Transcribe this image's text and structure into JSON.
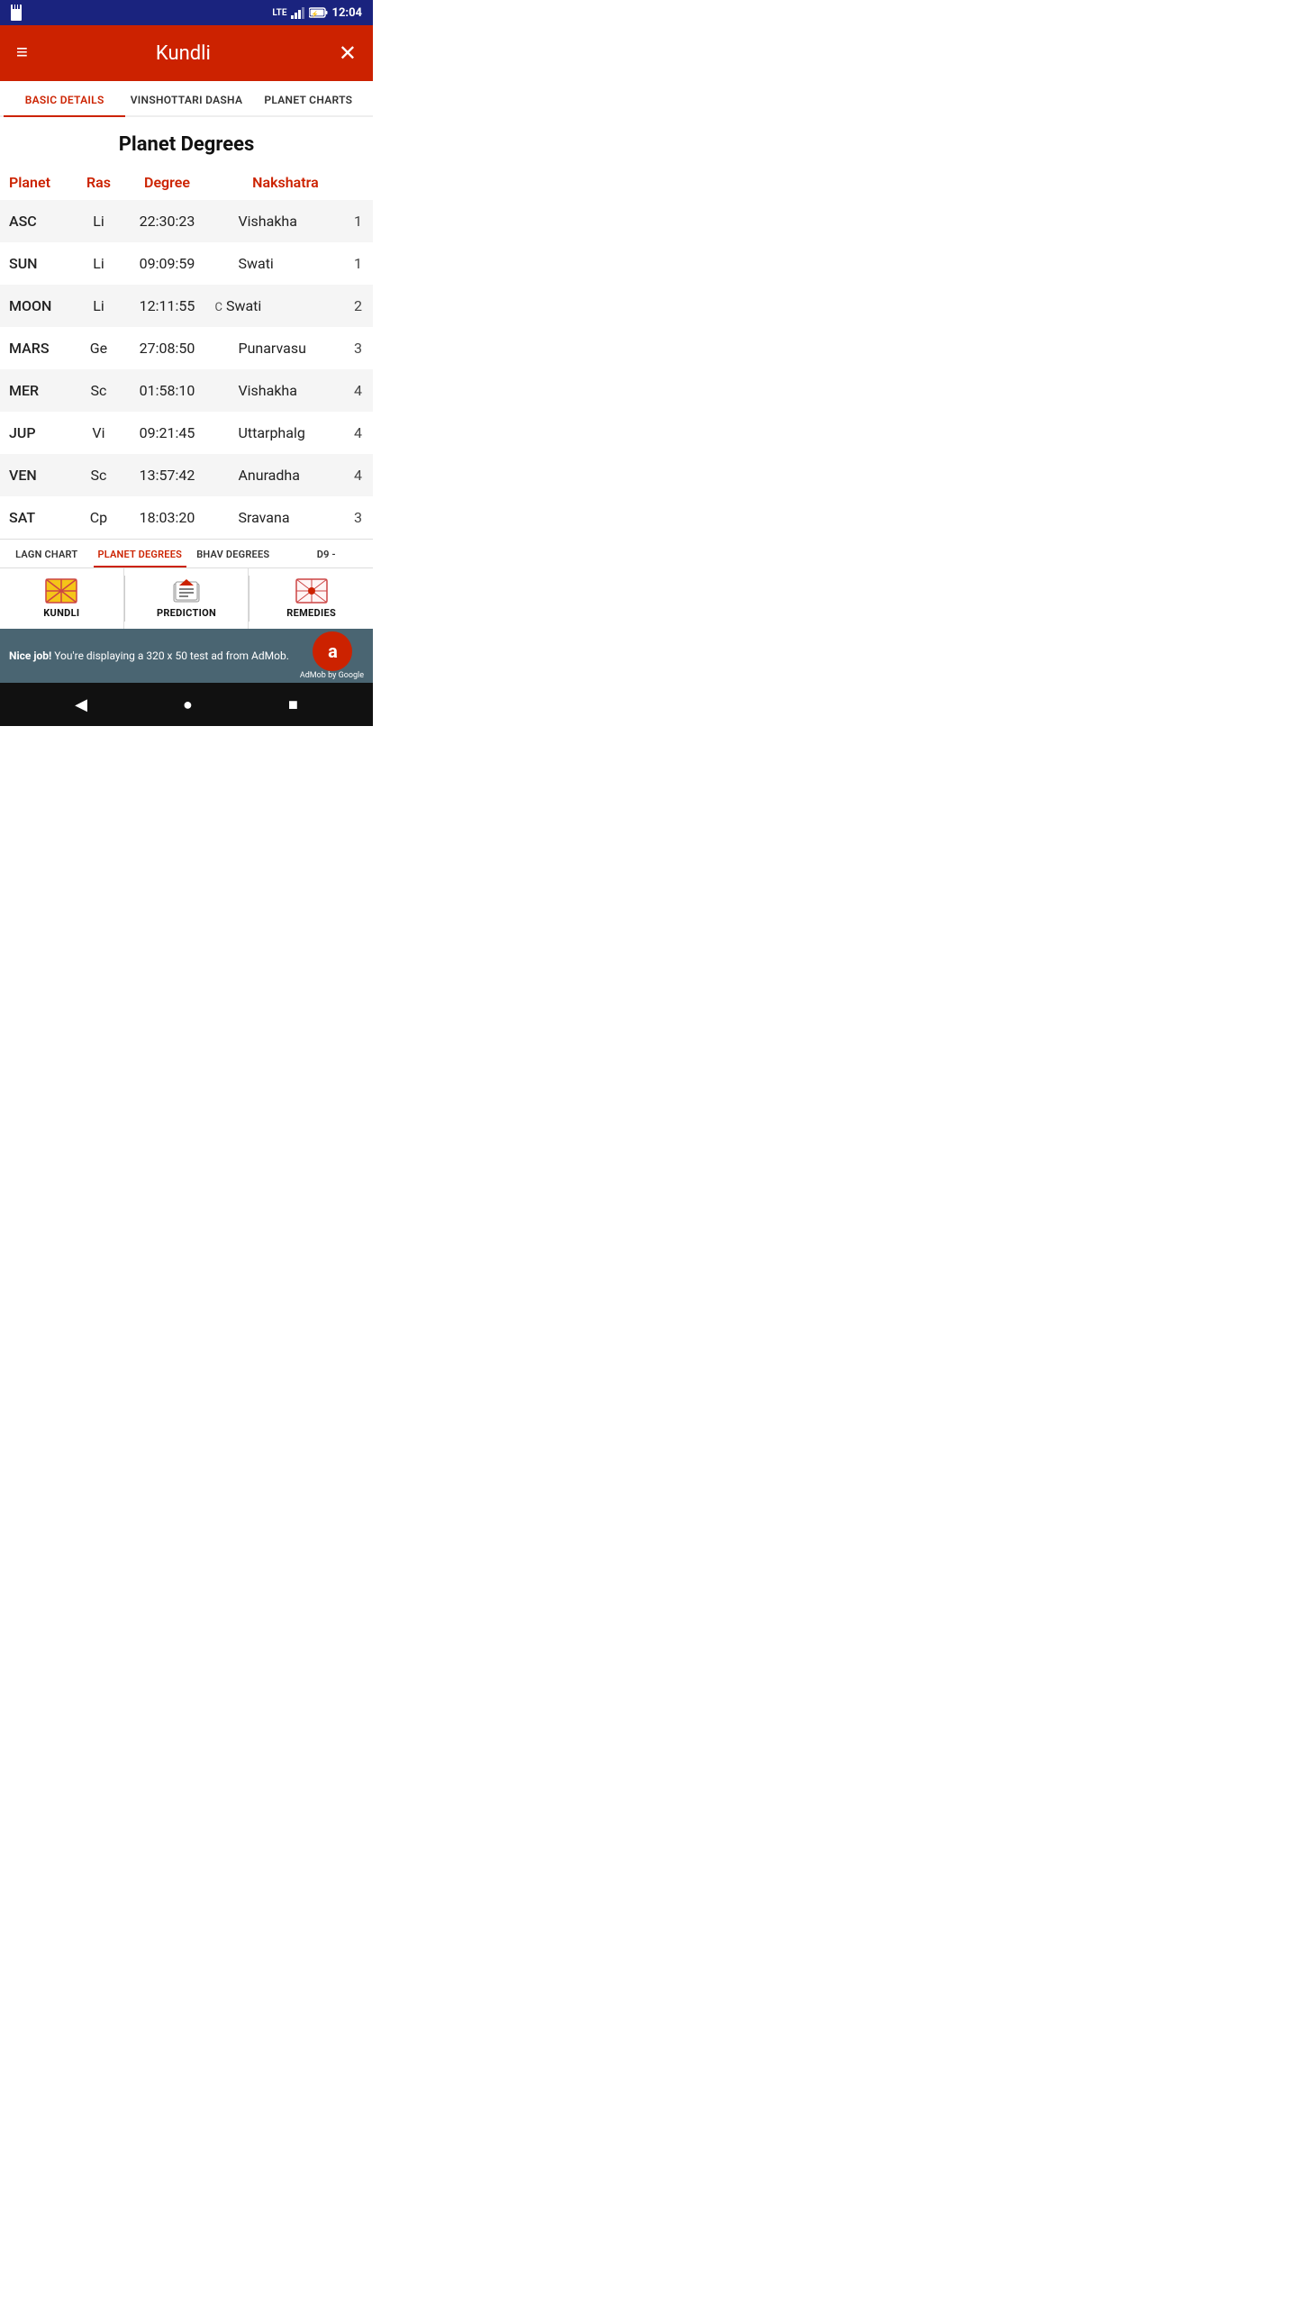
{
  "statusBar": {
    "time": "12:04",
    "lte": "LTE",
    "battery": "⚡"
  },
  "header": {
    "menu_icon": "≡",
    "title": "Kundli",
    "close_icon": "✕"
  },
  "tabs": [
    {
      "id": "basic-details",
      "label": "BASIC DETAILS",
      "active": true
    },
    {
      "id": "vinshottari-dasha",
      "label": "VINSHOTTARI DASHA",
      "active": false
    },
    {
      "id": "planet-charts",
      "label": "PLANET CHARTS",
      "active": false
    }
  ],
  "pageTitle": "Planet Degrees",
  "tableHeaders": {
    "planet": "Planet",
    "ras": "Ras",
    "degree": "Degree",
    "nakshatra": "Nakshatra"
  },
  "tableRows": [
    {
      "planet": "ASC",
      "ras": "Li",
      "degree": "22:30:23",
      "flag": "",
      "nakshatra": "Vishakha",
      "pada": "1"
    },
    {
      "planet": "SUN",
      "ras": "Li",
      "degree": "09:09:59",
      "flag": "",
      "nakshatra": "Swati",
      "pada": "1"
    },
    {
      "planet": "MOON",
      "ras": "Li",
      "degree": "12:11:55",
      "flag": "C",
      "nakshatra": "Swati",
      "pada": "2"
    },
    {
      "planet": "MARS",
      "ras": "Ge",
      "degree": "27:08:50",
      "flag": "",
      "nakshatra": "Punarvasu",
      "pada": "3"
    },
    {
      "planet": "MER",
      "ras": "Sc",
      "degree": "01:58:10",
      "flag": "",
      "nakshatra": "Vishakha",
      "pada": "4"
    },
    {
      "planet": "JUP",
      "ras": "Vi",
      "degree": "09:21:45",
      "flag": "",
      "nakshatra": "Uttarphalg",
      "pada": "4"
    },
    {
      "planet": "VEN",
      "ras": "Sc",
      "degree": "13:57:42",
      "flag": "",
      "nakshatra": "Anuradha",
      "pada": "4"
    },
    {
      "planet": "SAT",
      "ras": "Cp",
      "degree": "18:03:20",
      "flag": "",
      "nakshatra": "Sravana",
      "pada": "3"
    }
  ],
  "subTabs": [
    {
      "id": "lagn-chart",
      "label": "LAGN CHART",
      "active": false
    },
    {
      "id": "planet-degrees",
      "label": "PLANET DEGREES",
      "active": true
    },
    {
      "id": "bhav-degrees",
      "label": "BHAV DEGREES",
      "active": false
    },
    {
      "id": "d9",
      "label": "D9 -",
      "active": false
    }
  ],
  "bottomNav": [
    {
      "id": "kundli",
      "label": "KUNDLI",
      "icon": "kundli"
    },
    {
      "id": "prediction",
      "label": "PREDICTION",
      "icon": "prediction"
    },
    {
      "id": "remedies",
      "label": "REMEDIES",
      "icon": "remedies"
    }
  ],
  "adBanner": {
    "text_bold": "Nice job!",
    "text": "You're displaying a 320 x 50 test ad from AdMob.",
    "logo_text": "a",
    "by_text": "AdMob by Google"
  },
  "androidNav": {
    "back": "◀",
    "home": "●",
    "recent": "■"
  }
}
